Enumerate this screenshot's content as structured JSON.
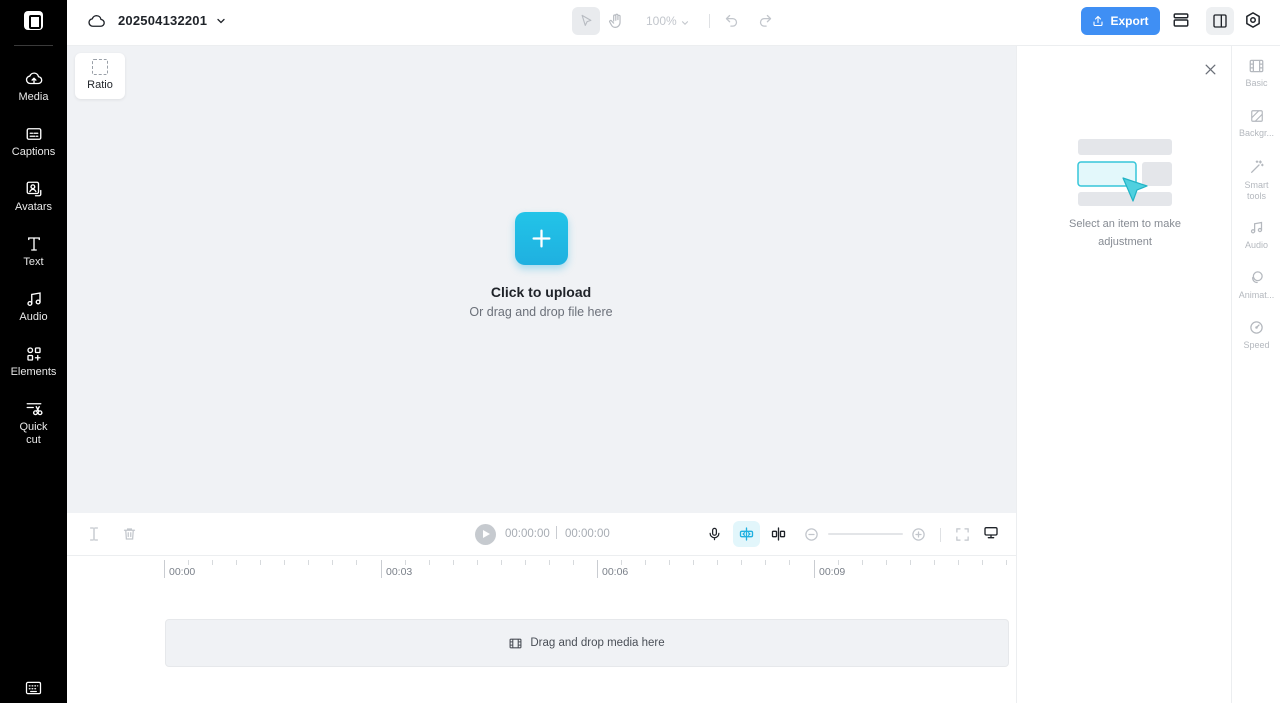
{
  "sidebar": {
    "items": [
      {
        "label": "Media",
        "icon": "cloud-upload-icon"
      },
      {
        "label": "Captions",
        "icon": "captions-icon"
      },
      {
        "label": "Avatars",
        "icon": "avatar-icon"
      },
      {
        "label": "Text",
        "icon": "text-icon"
      },
      {
        "label": "Audio",
        "icon": "music-note-icon"
      },
      {
        "label": "Elements",
        "icon": "elements-icon"
      },
      {
        "label": "Quick cut",
        "icon": "scissors-icon"
      }
    ]
  },
  "header": {
    "project_name": "202504132201",
    "zoom": "100%",
    "export_label": "Export"
  },
  "canvas": {
    "ratio_label": "Ratio",
    "upload_title": "Click to upload",
    "upload_subtitle": "Or drag and drop file here"
  },
  "timeline": {
    "current_time": "00:00:00",
    "total_time": "00:00:00",
    "ruler_labels": [
      "00:00",
      "00:03",
      "00:06",
      "00:09"
    ],
    "drop_label": "Drag and drop media here"
  },
  "right_panel": {
    "hint": "Select an item to make adjustment"
  },
  "rail": {
    "items": [
      {
        "label": "Basic",
        "icon": "film-icon"
      },
      {
        "label": "Backgr...",
        "icon": "background-icon"
      },
      {
        "label": "Smart tools",
        "icon": "magic-wand-icon"
      },
      {
        "label": "Audio",
        "icon": "music-note-icon"
      },
      {
        "label": "Animat...",
        "icon": "animation-icon"
      },
      {
        "label": "Speed",
        "icon": "speed-icon"
      }
    ]
  },
  "colors": {
    "accent": "#3f8ff4",
    "upload": "#1fb0e0",
    "sidebar_bg": "#000000",
    "canvas_bg": "#f0f2f5"
  }
}
